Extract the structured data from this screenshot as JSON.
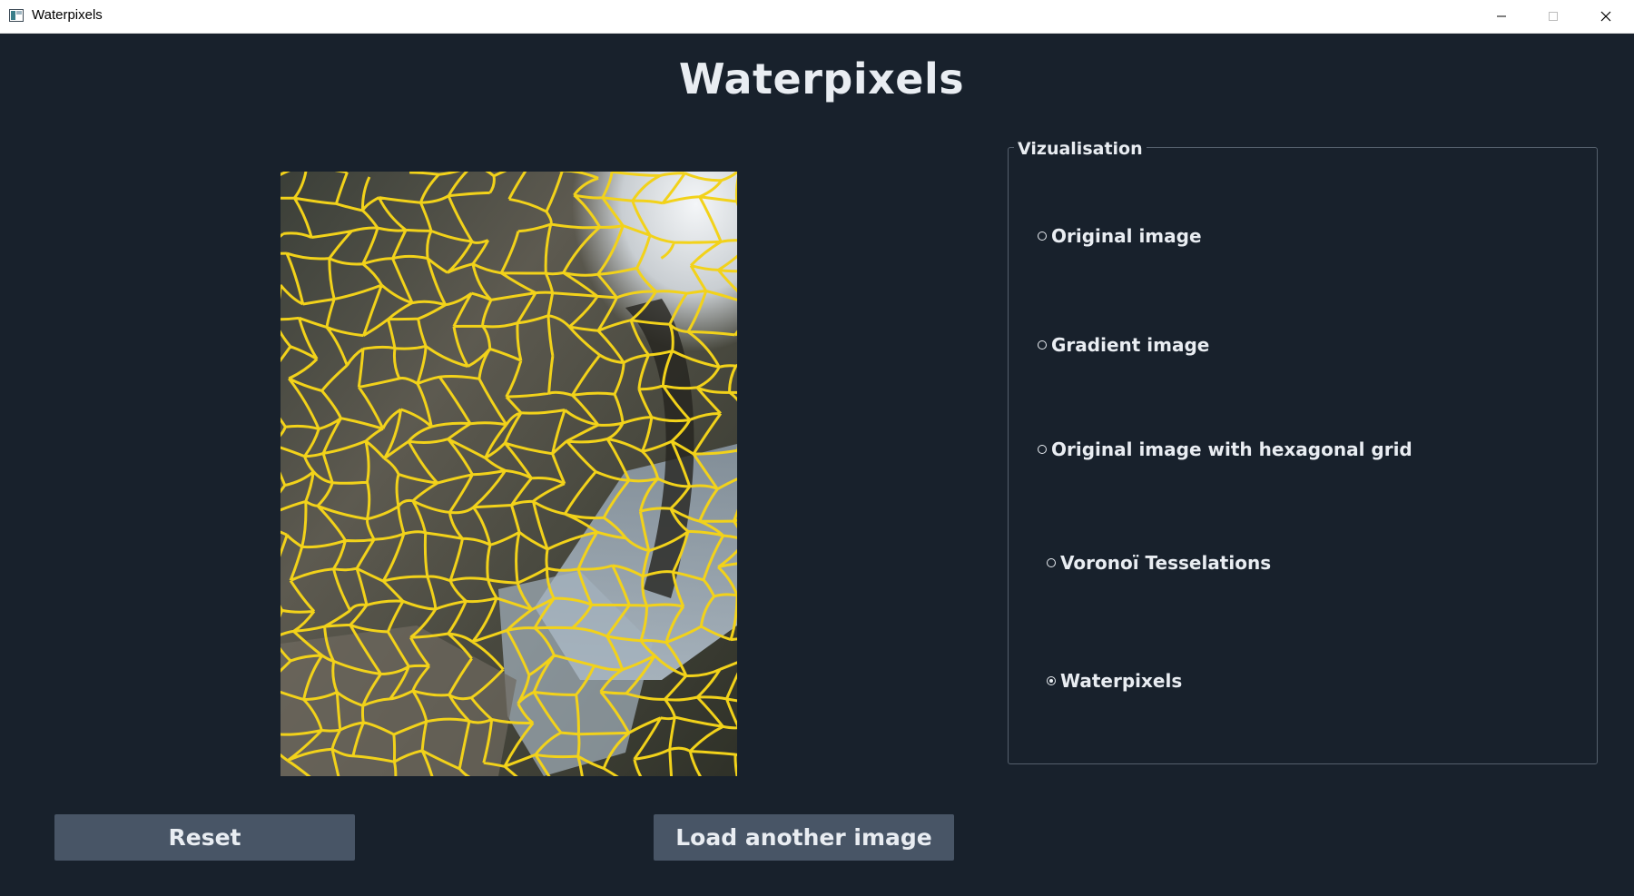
{
  "window": {
    "title": "Waterpixels"
  },
  "heading": "Waterpixels",
  "visualisation": {
    "legend": "Vizualisation",
    "options": [
      {
        "label": "Original image",
        "checked": false
      },
      {
        "label": "Gradient image",
        "checked": false
      },
      {
        "label": "Original image with hexagonal grid",
        "checked": false
      },
      {
        "label": "Voronoï Tesselations",
        "checked": false
      },
      {
        "label": "Waterpixels",
        "checked": true
      }
    ]
  },
  "buttons": {
    "reset": "Reset",
    "load": "Load another image"
  },
  "colors": {
    "background": "#18212c",
    "button": "#485566",
    "text": "#e9edf2",
    "contour": "#f2d21a"
  }
}
